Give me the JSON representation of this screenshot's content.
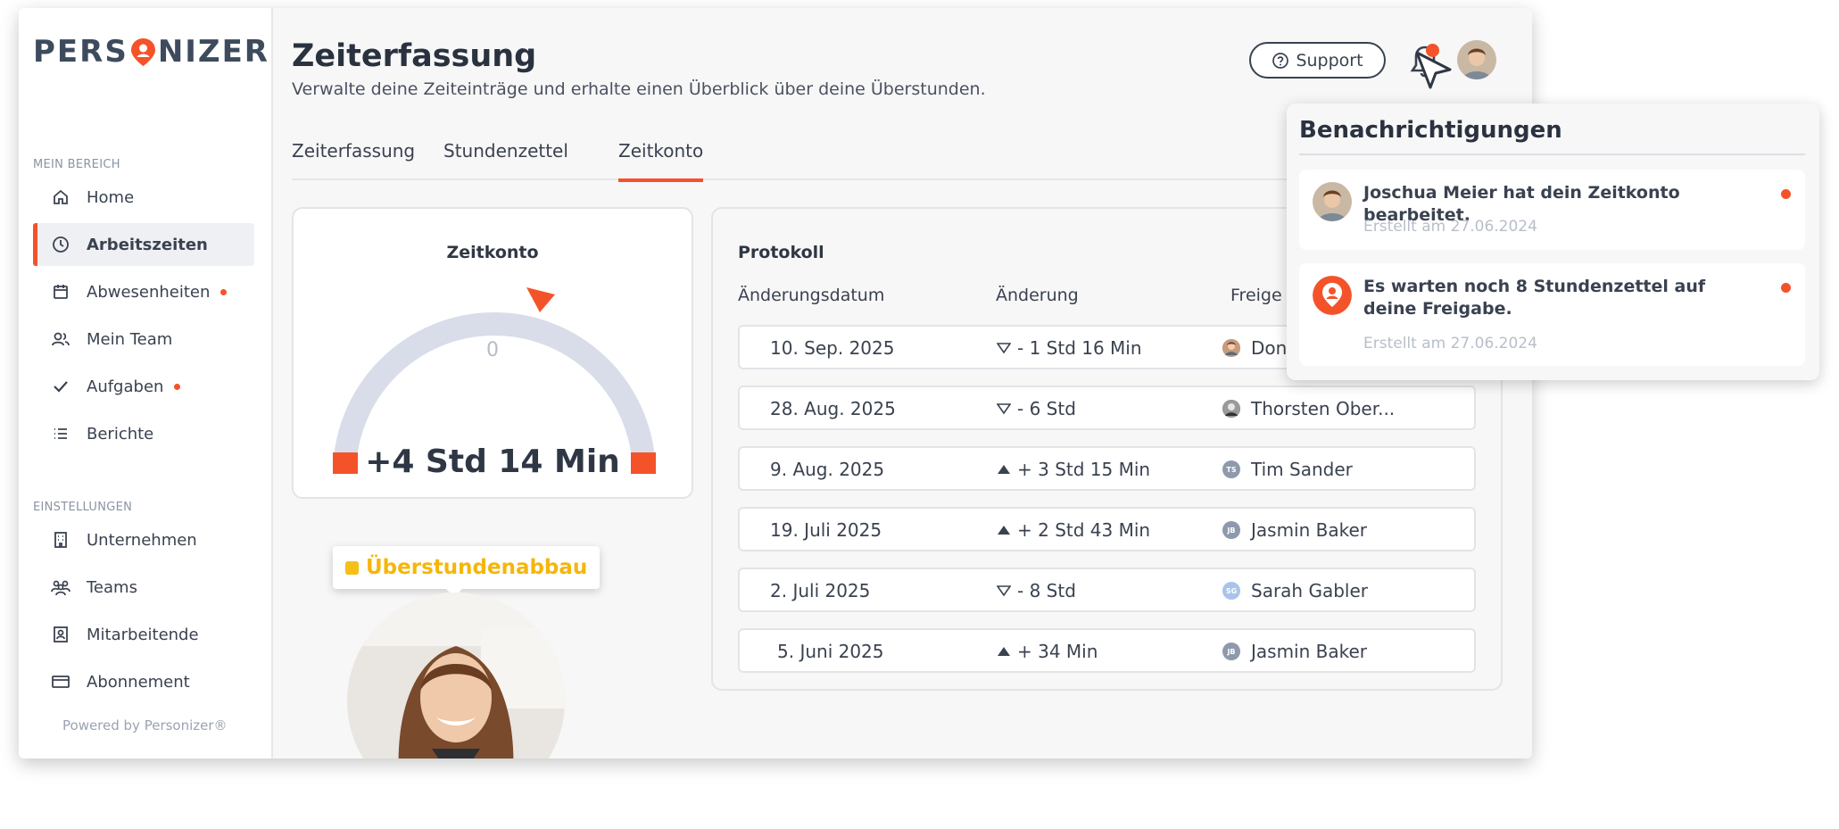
{
  "brand": {
    "logo_left": "PERS",
    "logo_right": "NIZER",
    "accent": "#f4532a"
  },
  "sidebar": {
    "section_main": "MEIN BEREICH",
    "section_settings": "EINSTELLUNGEN",
    "main_items": [
      {
        "label": "Home",
        "icon": "home-icon"
      },
      {
        "label": "Arbeitszeiten",
        "icon": "clock-icon",
        "active": true
      },
      {
        "label": "Abwesenheiten",
        "icon": "calendar-icon",
        "dot": true
      },
      {
        "label": "Mein Team",
        "icon": "users-icon"
      },
      {
        "label": "Aufgaben",
        "icon": "check-icon",
        "dot": true
      },
      {
        "label": "Berichte",
        "icon": "list-icon"
      }
    ],
    "settings_items": [
      {
        "label": "Unternehmen",
        "icon": "building-icon"
      },
      {
        "label": "Teams",
        "icon": "teams-icon"
      },
      {
        "label": "Mitarbeitende",
        "icon": "badge-icon"
      },
      {
        "label": "Abonnement",
        "icon": "credit-card-icon"
      }
    ],
    "powered": "Powered by Personizer®"
  },
  "header": {
    "title": "Zeiterfassung",
    "subtitle": "Verwalte deine Zeiteinträge und erhalte einen Überblick über deine Überstunden.",
    "support_label": "Support"
  },
  "tabs": [
    {
      "label": "Zeiterfassung"
    },
    {
      "label": "Stundenzettel"
    },
    {
      "label": "Zeitkonto",
      "active": true
    }
  ],
  "zeitkonto": {
    "title": "Zeitkonto",
    "zero_label": "0",
    "value": "+4 Std 14 Min"
  },
  "protocol": {
    "title": "Protokoll",
    "columns": [
      "Änderungsdatum",
      "Änderung",
      "Freige"
    ],
    "rows": [
      {
        "date": "10. Sep. 2025",
        "direction": "down",
        "change": "- 1 Std 16 Min",
        "person": "Don",
        "avatar": "photo"
      },
      {
        "date": "28. Aug. 2025",
        "direction": "down",
        "change": "- 6 Std",
        "person": "Thorsten Ober...",
        "avatar": "photo"
      },
      {
        "date": "9. Aug. 2025",
        "direction": "up",
        "change": "+ 3 Std 15 Min",
        "person": "Tim Sander",
        "initials": "TS",
        "color": "#8e9aab"
      },
      {
        "date": "19. Juli 2025",
        "direction": "up",
        "change": "+ 2 Std 43 Min",
        "person": "Jasmin Baker",
        "initials": "JB",
        "color": "#8e9aab"
      },
      {
        "date": "2. Juli 2025",
        "direction": "down",
        "change": " - 8 Std",
        "person": "Sarah Gabler",
        "initials": "SG",
        "color": "#a9c4ea"
      },
      {
        "date": "5. Juni 2025",
        "direction": "up",
        "change": "+ 34 Min",
        "person": "Jasmin Baker",
        "initials": "JB",
        "color": "#8e9aab"
      }
    ]
  },
  "badge": {
    "label": "Überstundenabbau"
  },
  "notifications": {
    "title": "Benachrichtigungen",
    "items": [
      {
        "text": "Joschua Meier hat dein Zeitkonto bearbeitet.",
        "date": "Erstellt am 27.06.2024",
        "avatar": "photo"
      },
      {
        "text": "Es warten noch 8 Stundenzettel auf deine Freigabe.",
        "date": "Erstellt am 27.06.2024",
        "avatar": "logo"
      }
    ]
  }
}
